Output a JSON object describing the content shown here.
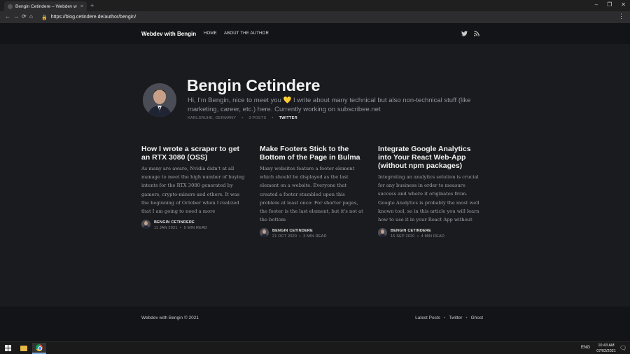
{
  "browser": {
    "tab_title": "Bengin Cetindere – Webdev w",
    "tab_close": "×",
    "new_tab": "+",
    "win_min": "–",
    "win_restore": "❐",
    "win_close": "✕",
    "back": "←",
    "forward": "→",
    "reload": "⟳",
    "home": "⌂",
    "lock": "🔒",
    "url": "https://blog.cetindere.de/author/bengin/",
    "menu": "⋮"
  },
  "site": {
    "logo": "Webdev with Bengin",
    "nav": [
      {
        "label": "HOME"
      },
      {
        "label": "ABOUT THE AUTHOR"
      }
    ],
    "twitter_icon": "twitter-icon",
    "rss_icon": "rss-icon"
  },
  "author": {
    "name": "Bengin Cetindere",
    "bio_pre": "Hi, I'm Bengin, nice to meet you",
    "bio_heart": "💛",
    "bio_post": "I write about many technical but also non-technical stuff (like marketing, career, etc.) here. Currently working on subscribee.net",
    "location": "KARLSRUHE, GERMANY",
    "dot": "•",
    "posts": "3 POSTS",
    "twitter": "TWITTER"
  },
  "posts": [
    {
      "title": "How I wrote a scraper to get an RTX 3080 (OSS)",
      "excerpt": "As many are aware, Nvidia didn't at all manage to meet the high number of buying intents for the RTX 3080 generated by gamers, crypto-miners and others. It was the beginning of October when I realized that I am going to need a more",
      "author": "BENGIN CETINDERE",
      "date": "11 JAN 2021",
      "read": "5 MIN READ"
    },
    {
      "title": "Make Footers Stick to the Bottom of the Page in Bulma",
      "excerpt": "Many websites feature a footer element which should be displayed as the last element on a website. Everyone that created a footer stumbled upon this problem at least once: For shorter pages, the footer is the last element, but it's not at the bottom",
      "author": "BENGIN CETINDERE",
      "date": "21 OCT 2020",
      "read": "3 MIN READ"
    },
    {
      "title": "Integrate Google Analytics into Your React Web-App (without npm packages)",
      "excerpt": "Integrating an analytics solution is crucial for any business in order to measure success and where it originates from. Google Analytics is probably the most well known tool, so in this article you will learn how to use it in your React App without",
      "author": "BENGIN CETINDERE",
      "date": "16 SEP 2020",
      "read": "4 MIN READ"
    }
  ],
  "footer": {
    "copyright": "Webdev with Bengin © 2021",
    "links": [
      "Latest Posts",
      "Twitter",
      "Ghost"
    ],
    "sep": "•"
  },
  "taskbar": {
    "lang": "ENG",
    "time": "10:43 AM",
    "date": "07/02/2021",
    "notif": "🗨"
  }
}
